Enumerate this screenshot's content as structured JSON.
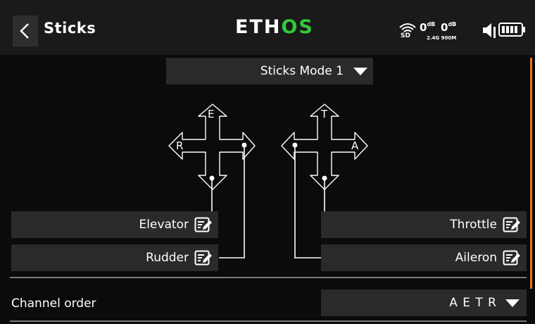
{
  "header": {
    "title": "Sticks",
    "logo_part1": "ETH",
    "logo_part2": "OS",
    "rssi_24": "0",
    "rssi_900": "0",
    "rssi_unit": "dB",
    "rssi_sub": "2.4G 900M"
  },
  "mode_select": {
    "value": "Sticks Mode 1"
  },
  "left_stick": {
    "top": "E",
    "left": "R"
  },
  "right_stick": {
    "top": "T",
    "right": "A"
  },
  "fields": {
    "elevator": "Elevator",
    "rudder": "Rudder",
    "throttle": "Throttle",
    "aileron": "Aileron"
  },
  "channel_order": {
    "label": "Channel order",
    "value": "A E T R"
  },
  "colors": {
    "accent_scroll": "#e8761a",
    "logo_green": "#33c93b",
    "panel": "#2a2a2a",
    "header_bg": "#1a1a1a"
  },
  "icons": [
    "back-chevron-icon",
    "wifi-icon",
    "volume-icon",
    "battery-icon",
    "edit-icon",
    "caret-down-icon",
    "stick-cross-icon"
  ]
}
